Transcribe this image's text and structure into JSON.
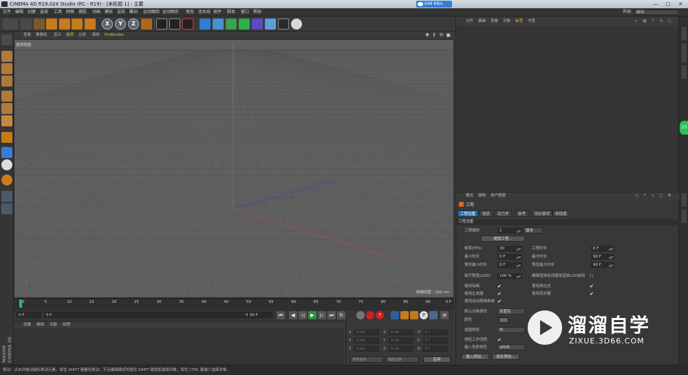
{
  "window": {
    "title": "CINEMA 4D R19.024 Studio (RC - R19) - [未标题 1] - 主要",
    "net_speed": "648 KB/s",
    "minimize": "—",
    "maximize": "□",
    "close": "✕"
  },
  "menubar": {
    "items": [
      "文件",
      "编辑",
      "创建",
      "选择",
      "工具",
      "网格",
      "捕捉",
      "动画",
      "模拟",
      "渲染",
      "雕刻",
      "运动跟踪",
      "运动图形",
      "角色",
      "流水线",
      "插件",
      "脚本",
      "窗口",
      "帮助"
    ],
    "layout_label": "界面:",
    "layout_value": "启动"
  },
  "viewport": {
    "menu": [
      "查看",
      "摄像机",
      "显示",
      "选项",
      "过滤",
      "面板",
      "ProRender"
    ],
    "nav_icons": "✥ ⇕ ⟲ ▣",
    "label": "透视视图",
    "grid_spacing": "网格间距 : 100 cm"
  },
  "timeline": {
    "ticks": [
      "0",
      "5",
      "10",
      "15",
      "20",
      "25",
      "30",
      "35",
      "40",
      "45",
      "50",
      "55",
      "60",
      "65",
      "70",
      "75",
      "80",
      "85",
      "90"
    ],
    "end_frame": "0 F"
  },
  "transport": {
    "current_frame": "0 F",
    "start_frame": "0 F",
    "range_end": "90 F",
    "end_frame": "90 F"
  },
  "material_manager": {
    "menu": [
      "创建",
      "编辑",
      "功能",
      "纹理"
    ],
    "brand_line1": "MAXON",
    "brand_line2": "CINEMA 4D"
  },
  "coordinates": {
    "rows": [
      {
        "a": "X",
        "av": "0 cm",
        "b": "X",
        "bv": "0 cm",
        "c": "H",
        "cv": "0 °"
      },
      {
        "a": "Y",
        "av": "0 cm",
        "b": "Y",
        "bv": "0 cm",
        "c": "P",
        "cv": "0 °"
      },
      {
        "a": "Z",
        "av": "0 cm",
        "b": "Z",
        "bv": "0 cm",
        "c": "B",
        "cv": "0 °"
      }
    ],
    "mode1": "世界坐标",
    "mode2": "缩放比例",
    "apply": "应用"
  },
  "object_manager": {
    "menu": [
      "文件",
      "编辑",
      "查看",
      "对象",
      "标签",
      "书签"
    ]
  },
  "attribute_manager": {
    "menu": [
      "模式",
      "编辑",
      "用户数据"
    ],
    "title": "工程",
    "tabs": [
      "工程设置",
      "信息",
      "动力学",
      "参考",
      "待办事项",
      "帧插值"
    ],
    "section": "工程设置",
    "project_scale_label": "工程缩放",
    "project_scale_value": "1",
    "project_scale_unit": "厘米",
    "scale_project_btn": "缩放工程...",
    "fps_label": "帧率(FPS)",
    "fps_value": "30",
    "project_time_label": "工程时长",
    "project_time_value": "0 F",
    "min_time_label": "最小时长",
    "min_time_value": "0 F",
    "max_time_label": "最大时长",
    "max_time_value": "90 F",
    "preview_min_label": "预览最小时长",
    "preview_min_value": "0 F",
    "preview_max_label": "预览最大时长",
    "preview_max_value": "90 F",
    "lod_label": "细节程度(LOD)",
    "lod_value": "100 %",
    "render_lod_label": "编辑渲染检视使用渲染LOD级别",
    "use_anim_label": "使用动画",
    "use_expr_label": "使用表达式",
    "use_gen_label": "使用生成器",
    "use_deform_label": "使用变形器",
    "use_motion_label": "使用运动剪辑系统",
    "default_color_label": "默认对象颜色",
    "default_color_value": "灰蓝色",
    "color_label": "颜色",
    "view_clip_label": "视图修剪",
    "view_clip_value": "中",
    "linear_workflow_label": "线性工作流程",
    "input_color_label": "输入色彩特性",
    "input_color_value": "sRGB",
    "load_preset_btn": "载入预设...",
    "save_preset_btn": "保存预设..."
  },
  "right_strip": {
    "badge": "23"
  },
  "statusbar": {
    "text": "移动：点击并拖动鼠标移动元素。按住 SHIFT 键量化移动；节点编辑模式时按住 SHIFT 键增加选择对象；按住 CTRL 键减少选择对象。"
  },
  "watermark": {
    "title": "溜溜自学",
    "url": "ZIXUE.3D66.COM"
  },
  "colors": {
    "accent_blue": "#1e6fb8",
    "playhead_green": "#19c36c",
    "viewport_bg": "#5f5f5f"
  }
}
